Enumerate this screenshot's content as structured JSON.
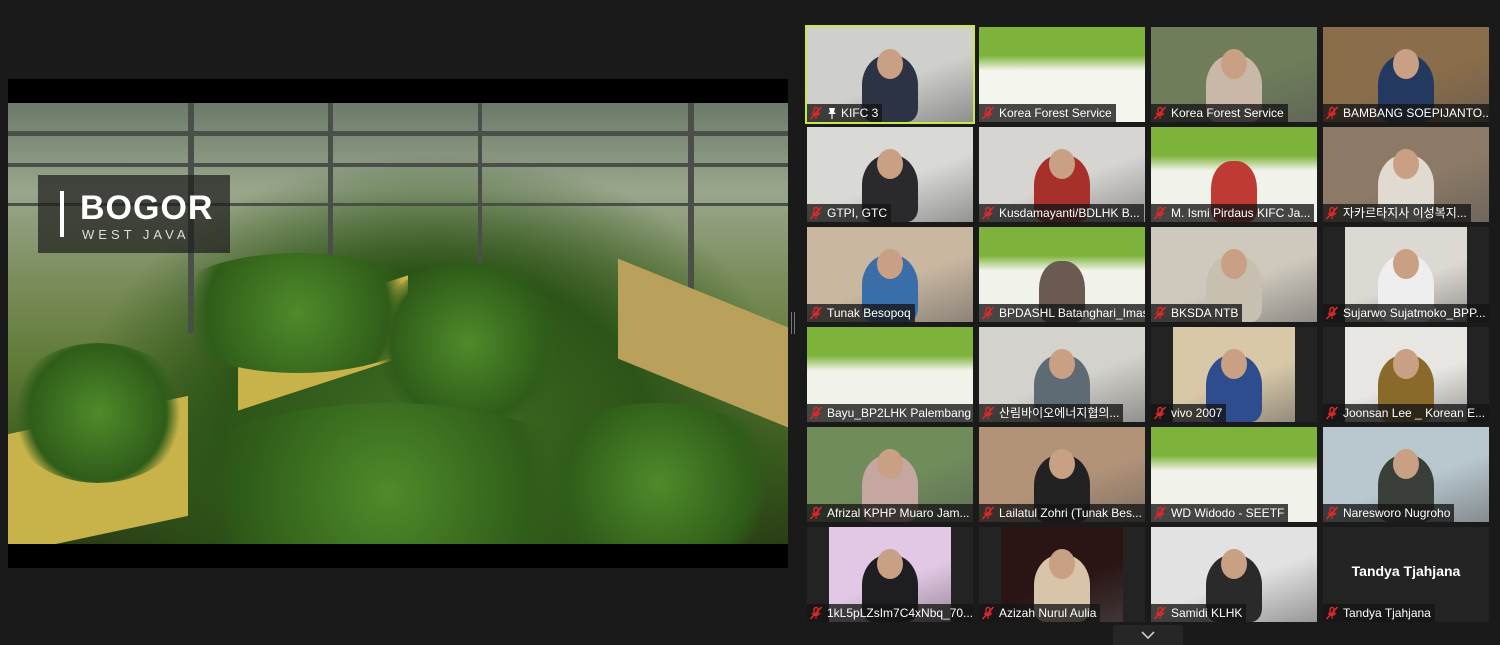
{
  "main_video": {
    "caption_city": "BOGOR",
    "caption_region": "WEST JAVA"
  },
  "colors": {
    "active_speaker_border": "#c7e84a",
    "muted_icon": "#e02828",
    "background": "#1a1a1a"
  },
  "tiles": [
    {
      "name": "KIFC 3",
      "muted": true,
      "pinned": true,
      "active": true,
      "tone": "#cfcfcc",
      "skin": "#2b3345",
      "video": "full"
    },
    {
      "name": "Korea Forest Service",
      "muted": true,
      "tone": "#f4f6ee",
      "accent": "#7db33a",
      "video": "slide"
    },
    {
      "name": "Korea Forest Service",
      "muted": true,
      "tone": "#6f7d5a",
      "skin": "#c9b8a8",
      "video": "full"
    },
    {
      "name": "BAMBANG SOEPIJANTO...",
      "muted": true,
      "tone": "#8a6d4a",
      "skin": "#24395f",
      "video": "full"
    },
    {
      "name": "GTPI, GTC",
      "muted": true,
      "tone": "#d9d9d6",
      "skin": "#2a2a2e",
      "video": "full"
    },
    {
      "name": "Kusdamayanti/BDLHK B...",
      "muted": true,
      "tone": "#d7d5d2",
      "skin": "#a8302a",
      "video": "full"
    },
    {
      "name": "M. Ismi Pirdaus KIFC Ja...",
      "muted": true,
      "tone": "#f1f3ea",
      "accent": "#7db33a",
      "skin": "#c03a34",
      "video": "slide"
    },
    {
      "name": "자카르타지사 이성복지...",
      "muted": true,
      "tone": "#8c7a66",
      "skin": "#e0dad0",
      "video": "full"
    },
    {
      "name": "Tunak Besopoq",
      "muted": true,
      "tone": "#c9b7a0",
      "skin": "#3a6ea8",
      "video": "full"
    },
    {
      "name": "BPDASHL Batanghari_Imas",
      "muted": true,
      "tone": "#f1f3ea",
      "accent": "#7db33a",
      "skin": "#6a5a52",
      "video": "slide"
    },
    {
      "name": "BKSDA NTB",
      "muted": true,
      "tone": "#cfc9bd",
      "skin": "#c7c0b0",
      "video": "full"
    },
    {
      "name": "Sujarwo Sujatmoko_BPP...",
      "muted": true,
      "tone": "#dcd8d2",
      "skin": "#eeeeee",
      "video": "pillar"
    },
    {
      "name": "Bayu_BP2LHK Palembang",
      "muted": true,
      "tone": "#f1f3ea",
      "accent": "#7db33a",
      "video": "slide"
    },
    {
      "name": "산림바이오에너지협의...",
      "muted": true,
      "tone": "#d4d2cc",
      "skin": "#5e6a74",
      "video": "full"
    },
    {
      "name": "vivo 2007",
      "muted": true,
      "tone": "#d8c8a8",
      "skin": "#2e4c8e",
      "video": "pillar"
    },
    {
      "name": "Joonsan Lee _ Korean E...",
      "muted": true,
      "tone": "#e8e6e2",
      "skin": "#8a6a2a",
      "video": "pillar"
    },
    {
      "name": "Afrizal KPHP Muaro Jam...",
      "muted": true,
      "tone": "#6f8c5a",
      "skin": "#c6a6a0",
      "video": "full"
    },
    {
      "name": "Lailatul Zohri (Tunak Bes...",
      "muted": true,
      "tone": "#b29378",
      "skin": "#222222",
      "video": "full"
    },
    {
      "name": "WD Widodo - SEETF",
      "muted": true,
      "tone": "#f1f3ea",
      "accent": "#7db33a",
      "video": "slide"
    },
    {
      "name": "Naresworo Nugroho",
      "muted": true,
      "tone": "#b9c8cf",
      "skin": "#3a3f3a",
      "video": "full"
    },
    {
      "name": "1kL5pLZsIm7C4xNbq_70...",
      "muted": true,
      "tone": "#e3c8e6",
      "skin": "#1e1e22",
      "video": "pillar"
    },
    {
      "name": "Azizah Nurul Aulia",
      "muted": true,
      "tone": "#2a1414",
      "skin": "#d8c4a8",
      "video": "pillar"
    },
    {
      "name": "Samidi KLHK",
      "muted": true,
      "tone": "#e2e2e2",
      "skin": "#2a2a2a",
      "video": "full"
    },
    {
      "name": "Tandya Tjahjana",
      "muted": true,
      "tone": "#232323",
      "video": "none",
      "display_name": "Tandya Tjahjana"
    }
  ],
  "controls": {
    "expand_icon": "chevron-down-icon"
  }
}
